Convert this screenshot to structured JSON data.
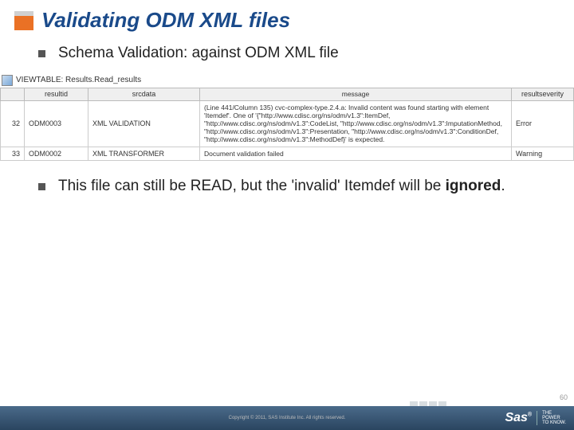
{
  "title": "Validating ODM XML files",
  "bullet1": "Schema Validation: against ODM XML file",
  "bullet2_a": "This file can still be READ, but the 'invalid' Itemdef will be ",
  "bullet2_b": "ignored",
  "bullet2_c": ".",
  "viewtable_title": "VIEWTABLE: Results.Read_results",
  "columns": {
    "c0": "",
    "c1": "resultid",
    "c2": "srcdata",
    "c3": "message",
    "c4": "resultseverity"
  },
  "rows": [
    {
      "n": "32",
      "id": "ODM0003",
      "src": "XML VALIDATION",
      "msg": "(Line 441/Column 135) cvc-complex-type.2.4.a: Invalid content was found starting with element 'Itemdef'. One of '{\"http://www.cdisc.org/ns/odm/v1.3\":ItemDef, \"http://www.cdisc.org/ns/odm/v1.3\":CodeList, \"http://www.cdisc.org/ns/odm/v1.3\":ImputationMethod, \"http://www.cdisc.org/ns/odm/v1.3\":Presentation, \"http://www.cdisc.org/ns/odm/v1.3\":ConditionDef, \"http://www.cdisc.org/ns/odm/v1.3\":MethodDef}' is expected.",
      "sev": "Error"
    },
    {
      "n": "33",
      "id": "ODM0002",
      "src": "XML TRANSFORMER",
      "msg": "Document validation failed",
      "sev": "Warning"
    }
  ],
  "page_number": "60",
  "copyright": "Copyright © 2011, SAS Institute Inc. All rights reserved.",
  "logo": "Sas",
  "tagline1": "THE",
  "tagline2": "POWER",
  "tagline3": "TO KNOW."
}
